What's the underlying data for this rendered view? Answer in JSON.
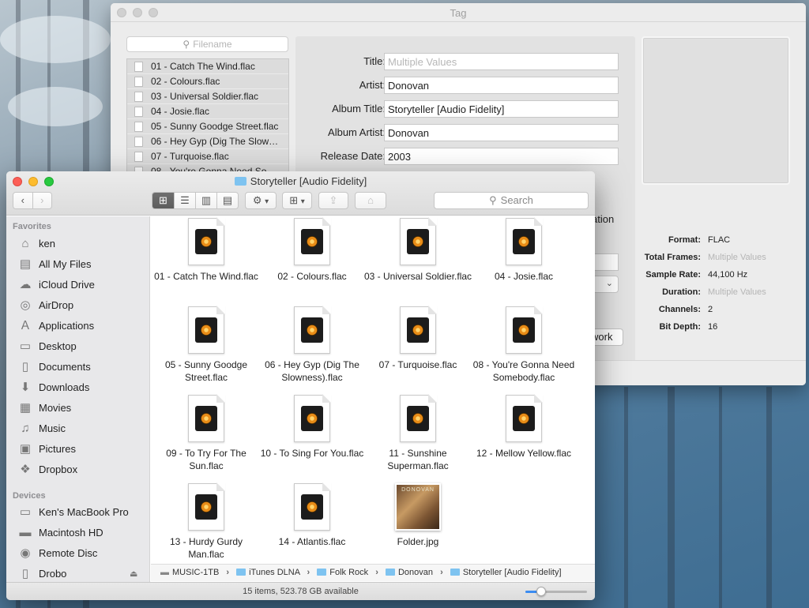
{
  "tag_window": {
    "title": "Tag",
    "search_placeholder": "Filename",
    "files": [
      "01 - Catch The Wind.flac",
      "02 - Colours.flac",
      "03 - Universal Soldier.flac",
      "04 - Josie.flac",
      "05 - Sunny Goodge Street.flac",
      "06 - Hey Gyp (Dig The Slow…",
      "07 - Turquoise.flac",
      "08 - You're Gonna Need So…"
    ],
    "fields": {
      "title_label": "Title:",
      "title_placeholder": "Multiple Values",
      "artist_label": "Artist:",
      "artist_value": "Donovan",
      "album_title_label": "Album Title:",
      "album_title_value": "Storyteller [Audio Fidelity]",
      "album_artist_label": "Album Artist:",
      "album_artist_value": "Donovan",
      "release_date_label": "Release Date:",
      "release_date_value": "2003"
    },
    "partially_hidden": {
      "composition_fragment": "ation",
      "artwork_button_fragment": "work"
    },
    "info": {
      "format_label": "Format:",
      "format_value": "FLAC",
      "total_frames_label": "Total Frames:",
      "total_frames_value": "Multiple Values",
      "sample_rate_label": "Sample Rate:",
      "sample_rate_value": "44,100 Hz",
      "duration_label": "Duration:",
      "duration_value": "Multiple Values",
      "channels_label": "Channels:",
      "channels_value": "2",
      "bit_depth_label": "Bit Depth:",
      "bit_depth_value": "16"
    }
  },
  "finder": {
    "title": "Storyteller [Audio Fidelity]",
    "search_label": "Search",
    "sidebar": {
      "favorites_heading": "Favorites",
      "favorites": [
        {
          "label": "ken",
          "icon": "home-icon"
        },
        {
          "label": "All My Files",
          "icon": "all-files-icon"
        },
        {
          "label": "iCloud Drive",
          "icon": "cloud-icon"
        },
        {
          "label": "AirDrop",
          "icon": "airdrop-icon"
        },
        {
          "label": "Applications",
          "icon": "applications-icon"
        },
        {
          "label": "Desktop",
          "icon": "desktop-icon"
        },
        {
          "label": "Documents",
          "icon": "documents-icon"
        },
        {
          "label": "Downloads",
          "icon": "downloads-icon"
        },
        {
          "label": "Movies",
          "icon": "movies-icon"
        },
        {
          "label": "Music",
          "icon": "music-icon"
        },
        {
          "label": "Pictures",
          "icon": "pictures-icon"
        },
        {
          "label": "Dropbox",
          "icon": "dropbox-icon"
        }
      ],
      "devices_heading": "Devices",
      "devices": [
        {
          "label": "Ken's MacBook Pro",
          "icon": "laptop-icon"
        },
        {
          "label": "Macintosh HD",
          "icon": "harddisk-icon"
        },
        {
          "label": "Remote Disc",
          "icon": "disc-icon"
        },
        {
          "label": "Drobo",
          "icon": "drive-icon"
        }
      ]
    },
    "items": [
      {
        "name": "01 - Catch The Wind.flac",
        "kind": "flac"
      },
      {
        "name": "02 - Colours.flac",
        "kind": "flac"
      },
      {
        "name": "03 - Universal Soldier.flac",
        "kind": "flac"
      },
      {
        "name": "04 - Josie.flac",
        "kind": "flac"
      },
      {
        "name": "05 - Sunny Goodge Street.flac",
        "kind": "flac"
      },
      {
        "name": "06 - Hey Gyp (Dig The Slowness).flac",
        "kind": "flac"
      },
      {
        "name": "07 - Turquoise.flac",
        "kind": "flac"
      },
      {
        "name": "08 - You're Gonna Need Somebody.flac",
        "kind": "flac"
      },
      {
        "name": "09 - To Try For The Sun.flac",
        "kind": "flac"
      },
      {
        "name": "10 - To Sing For You.flac",
        "kind": "flac"
      },
      {
        "name": "11 - Sunshine Superman.flac",
        "kind": "flac"
      },
      {
        "name": "12 - Mellow Yellow.flac",
        "kind": "flac"
      },
      {
        "name": "13 - Hurdy Gurdy Man.flac",
        "kind": "flac"
      },
      {
        "name": "14 - Atlantis.flac",
        "kind": "flac"
      },
      {
        "name": "Folder.jpg",
        "kind": "image",
        "thumb_text": "DONOVAN"
      }
    ],
    "path": [
      "MUSIC-1TB",
      "iTunes DLNA",
      "Folk Rock",
      "Donovan",
      "Storyteller [Audio Fidelity]"
    ],
    "status": "15 items, 523.78 GB available",
    "icon_size_fraction": 0.26
  }
}
